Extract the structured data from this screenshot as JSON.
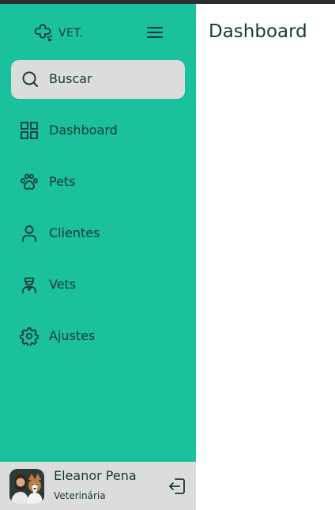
{
  "brand": {
    "name": "VET."
  },
  "sidebar": {
    "search_label": "Buscar",
    "items": [
      {
        "label": "Dashboard",
        "icon": "grid-icon"
      },
      {
        "label": "Pets",
        "icon": "paw-icon"
      },
      {
        "label": "Clientes",
        "icon": "user-icon"
      },
      {
        "label": "Vets",
        "icon": "vet-icon"
      },
      {
        "label": "Ajustes",
        "icon": "gear-icon"
      }
    ]
  },
  "user": {
    "name": "Eleanor Pena",
    "role": "Veterinária"
  },
  "main": {
    "title": "Dashboard"
  },
  "colors": {
    "sidebar": "#1ac19c",
    "text": "#153a33",
    "search_bg": "#dcdcdc",
    "topbar": "#2b2d33"
  }
}
